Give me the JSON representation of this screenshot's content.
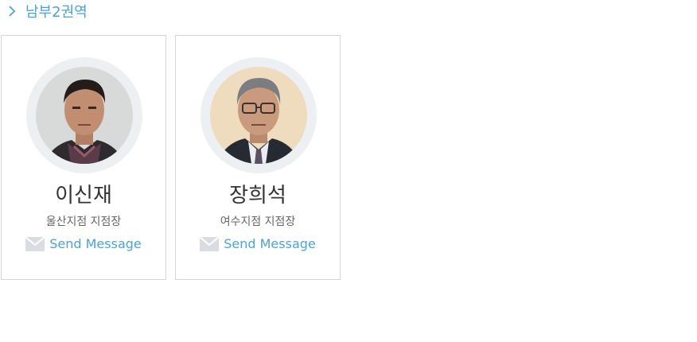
{
  "section": {
    "title": "남부2권역"
  },
  "people": [
    {
      "name": "이신재",
      "role": "울산지점 지점장",
      "action_label": "Send Message"
    },
    {
      "name": "장희석",
      "role": "여수지점 지점장",
      "action_label": "Send Message"
    }
  ],
  "colors": {
    "accent": "#4aa3d8",
    "ring": "#edf0f3",
    "border": "#d6d6d6",
    "mail_icon": "#d9dde2"
  }
}
